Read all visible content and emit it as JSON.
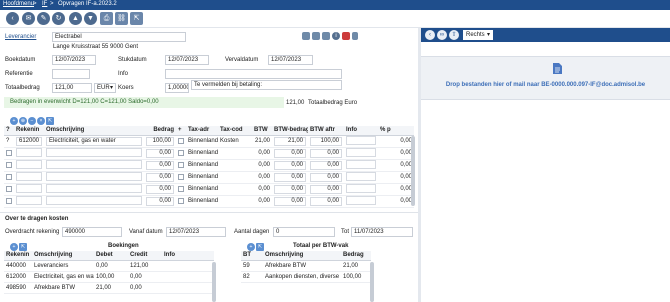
{
  "topbar": {
    "breadcrumb_home": "Hoofdmenu",
    "breadcrumb_sep1": ">",
    "breadcrumb_section": "IF",
    "breadcrumb_sep2": ">",
    "breadcrumb_page": "Opvragen IF-a.2023.2"
  },
  "form": {
    "leverancier_label": "Leverancier",
    "leverancier_value": "Electrabel",
    "address": "Lange Kruisstraat 55 9000 Gent",
    "boekdatum_label": "Boekdatum",
    "boekdatum_value": "12/07/2023",
    "stukdatum_label": "Stukdatum",
    "stukdatum_value": "12/07/2023",
    "vervaldatum_label": "Vervaldatum",
    "vervaldatum_value": "12/07/2023",
    "referentie_label": "Referentie",
    "referentie_value": "",
    "info_label": "Info",
    "info_value": "",
    "totaalbedrag_label": "Totaalbedrag",
    "totaalbedrag_value": "121,00",
    "currency_value": "EUR",
    "koers_label": "Koers",
    "koers_value": "1,00000",
    "betaling_label": "Te vermelden bij betaling:",
    "betaling_value": "",
    "balance_text": "Bedragen in evenwicht D=121,00 C=121,00 Saldo=0,00",
    "total_euro_value": "121,00",
    "total_euro_label": "Totaalbedrag Euro"
  },
  "lines": {
    "headers": [
      "?",
      "Rekenin",
      "Omschrijving",
      "Bedrag",
      "+",
      "Tax-adr",
      "Tax-cod",
      "BTW",
      "BTW-bedrag",
      "BTW aftr",
      "Info",
      "% p"
    ],
    "rows": [
      {
        "q": "?",
        "rekening": "612000",
        "omschrijving": "Electriciteit, gas en water",
        "bedrag": "100,00",
        "tax_adr": "Binnenland",
        "tax_cod": "Kosten",
        "btw": "21,00",
        "btw_bedrag": "21,00",
        "btw_aftr": "100,00",
        "info": "",
        "pct": "0,00"
      },
      {
        "q": "",
        "rekening": "",
        "omschrijving": "",
        "bedrag": "0,00",
        "tax_adr": "Binnenland",
        "tax_cod": "",
        "btw": "0,00",
        "btw_bedrag": "0,00",
        "btw_aftr": "0,00",
        "info": "",
        "pct": "0,00"
      },
      {
        "q": "",
        "rekening": "",
        "omschrijving": "",
        "bedrag": "0,00",
        "tax_adr": "Binnenland",
        "tax_cod": "",
        "btw": "0,00",
        "btw_bedrag": "0,00",
        "btw_aftr": "0,00",
        "info": "",
        "pct": "0,00"
      },
      {
        "q": "",
        "rekening": "",
        "omschrijving": "",
        "bedrag": "0,00",
        "tax_adr": "Binnenland",
        "tax_cod": "",
        "btw": "0,00",
        "btw_bedrag": "0,00",
        "btw_aftr": "0,00",
        "info": "",
        "pct": "0,00"
      },
      {
        "q": "",
        "rekening": "",
        "omschrijving": "",
        "bedrag": "0,00",
        "tax_adr": "Binnenland",
        "tax_cod": "",
        "btw": "0,00",
        "btw_bedrag": "0,00",
        "btw_aftr": "0,00",
        "info": "",
        "pct": "0,00"
      },
      {
        "q": "",
        "rekening": "",
        "omschrijving": "",
        "bedrag": "0,00",
        "tax_adr": "Binnenland",
        "tax_cod": "",
        "btw": "0,00",
        "btw_bedrag": "0,00",
        "btw_aftr": "0,00",
        "info": "",
        "pct": "0,00"
      }
    ]
  },
  "carry": {
    "title": "Over te dragen kosten",
    "overdracht_label": "Overdracht rekening",
    "overdracht_value": "490000",
    "vanaf_label": "Vanaf datum",
    "vanaf_value": "12/07/2023",
    "dagen_label": "Aantal dagen",
    "dagen_value": "0",
    "tot_label": "Tot",
    "tot_value": "11/07/2023"
  },
  "boekingen": {
    "title": "Boekingen",
    "headers": [
      "Rekenin",
      "Omschrijving",
      "Debet",
      "Credit",
      "Info"
    ],
    "rows": [
      {
        "rekening": "440000",
        "omschrijving": "Leveranciers",
        "debet": "0,00",
        "credit": "121,00",
        "info": ""
      },
      {
        "rekening": "612000",
        "omschrijving": "Electriciteit, gas en water",
        "debet": "100,00",
        "credit": "0,00",
        "info": ""
      },
      {
        "rekening": "498590",
        "omschrijving": "Afrekbare BTW",
        "debet": "21,00",
        "credit": "0,00",
        "info": ""
      }
    ]
  },
  "btwvak": {
    "title": "Totaal per BTW-vak",
    "headers": [
      "BT",
      "Omschrijving",
      "Bedrag"
    ],
    "rows": [
      {
        "bt": "59",
        "omschrijving": "Afrekbare BTW",
        "bedrag": "21,00"
      },
      {
        "bt": "82",
        "omschrijving": "Aankopen diensten, diverse goe",
        "bedrag": "100,00"
      }
    ]
  },
  "right": {
    "position_value": "Rechts",
    "drop_text": "Drop bestanden hier of mail naar BE-0000.000.097-IF@doc.admisol.be"
  },
  "colors": {
    "header": "#1f4e8c",
    "balance_bg": "#e8f6e6",
    "accent": "#5b8fd1"
  },
  "icons": {
    "toolbar": [
      "back-icon",
      "mail-icon",
      "edit-icon",
      "refresh-icon",
      "up-icon",
      "down-icon",
      "print-icon",
      "link-icon",
      "export-icon"
    ],
    "dropzone": "document-icon"
  }
}
